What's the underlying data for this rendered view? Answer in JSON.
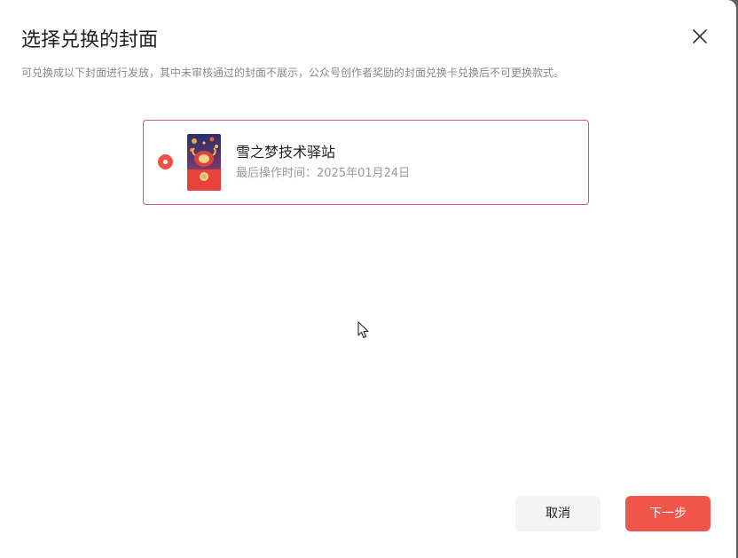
{
  "dialog": {
    "title": "选择兑换的封面",
    "subtitle": "可兑换成以下封面进行发放，其中未审核通过的封面不展示，公众号创作者奖励的封面兑换卡兑换后不可更换款式。"
  },
  "option": {
    "name": "雪之梦技术驿站",
    "last_modified": "最后操作时间：2025年01月24日",
    "selected": true
  },
  "footer": {
    "cancel_label": "取消",
    "next_label": "下一步"
  },
  "icons": {
    "close": "close-icon",
    "radio": "radio-selected-icon",
    "cursor": "mouse-pointer-icon"
  },
  "colors": {
    "accent": "#f0574a",
    "border_selected": "#e3565f",
    "cancel_bg": "#f4f4f4"
  }
}
